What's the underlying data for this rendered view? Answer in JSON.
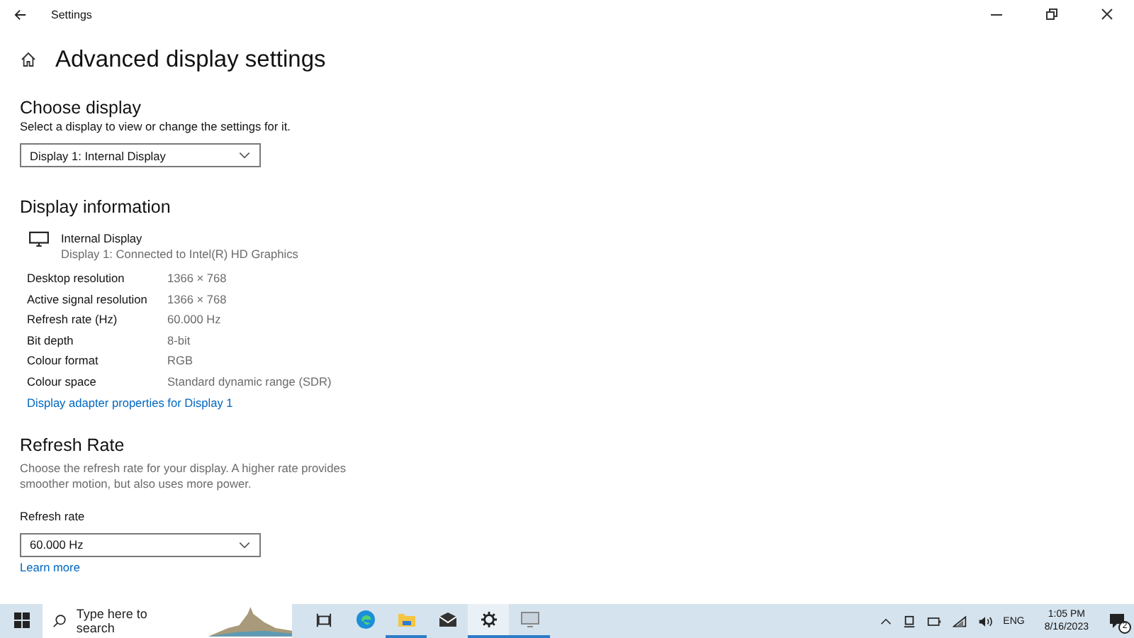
{
  "window": {
    "title": "Settings"
  },
  "page_title": "Advanced display settings",
  "choose_display": {
    "heading": "Choose display",
    "label": "Select a display to view or change the settings for it.",
    "value": "Display 1: Internal Display"
  },
  "display_information": {
    "heading": "Display information",
    "device_name": "Internal Display",
    "device_detail": "Display 1: Connected to Intel(R) HD Graphics",
    "rows": [
      {
        "label": "Desktop resolution",
        "value": "1366 × 768"
      },
      {
        "label": "Active signal resolution",
        "value": "1366 × 768"
      },
      {
        "label": "Refresh rate (Hz)",
        "value": "60.000 Hz"
      },
      {
        "label": "Bit depth",
        "value": "8-bit"
      },
      {
        "label": "Colour format",
        "value": "RGB"
      },
      {
        "label": "Colour space",
        "value": "Standard dynamic range (SDR)"
      }
    ],
    "link": "Display adapter properties for Display 1"
  },
  "refresh_rate": {
    "heading": "Refresh Rate",
    "description": "Choose the refresh rate for your display. A higher rate provides smoother motion, but also uses more power.",
    "label": "Refresh rate",
    "value": "60.000 Hz",
    "link": "Learn more"
  },
  "taskbar": {
    "search_placeholder": "Type here to search",
    "apps": [
      {
        "kind": "taskview",
        "selected": false,
        "running": false
      },
      {
        "kind": "edge",
        "selected": false,
        "running": false
      },
      {
        "kind": "explorer",
        "selected": false,
        "running": true
      },
      {
        "kind": "mail",
        "selected": false,
        "running": false
      },
      {
        "kind": "settings",
        "selected": true,
        "running": true
      },
      {
        "kind": "display",
        "selected": false,
        "running": true
      }
    ],
    "language": "ENG",
    "time": "1:05 PM",
    "date": "8/16/2023",
    "notification_count": "2"
  }
}
